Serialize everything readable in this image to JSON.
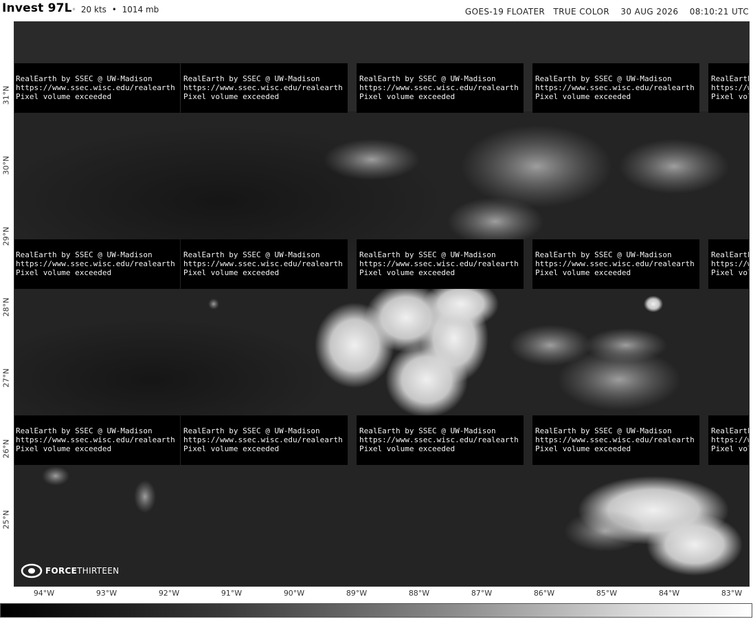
{
  "header": {
    "storm_name": "Invest 97L",
    "wind": "20 kts",
    "pressure": "1014 mb",
    "satellite": "GOES-19 FLOATER",
    "product": "TRUE COLOR",
    "date": "30 AUG 2026",
    "time": "08:10:21 UTC"
  },
  "overlay": {
    "line1": "RealEarth by SSEC @ UW-Madison",
    "line2": "https://www.ssec.wisc.edu/realearth",
    "line3": "Pixel volume exceeded"
  },
  "axes": {
    "latitudes": [
      "31°N",
      "30°N",
      "29°N",
      "28°N",
      "27°N",
      "26°N",
      "25°N"
    ],
    "longitudes": [
      "94°W",
      "93°W",
      "92°W",
      "91°W",
      "90°W",
      "89°W",
      "88°W",
      "87°W",
      "86°W",
      "85°W",
      "84°W",
      "83°W"
    ]
  },
  "logo": {
    "bold": "FORCE",
    "light": "THIRTEEN"
  },
  "colors": {
    "background": "#1e1e1e",
    "overlay": "#000000",
    "cloud": "#e6e6e6"
  },
  "colorbar": {
    "from": "#000000",
    "to": "#ffffff"
  }
}
